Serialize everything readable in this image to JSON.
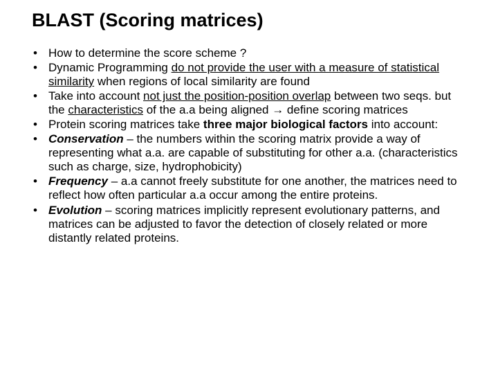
{
  "title": "BLAST (Scoring matrices)",
  "b1": "How to determine the score scheme ?",
  "b2a": "Dynamic Programming ",
  "b2b": "do not provide the user with a measure of statistical similarity",
  "b2c": " when regions of local similarity are found",
  "b3a": "Take into account ",
  "b3b": "not just the position-position overlap",
  "b3c": " between two seqs. but the ",
  "b3d": "characteristics",
  "b3e": " of the a.a being aligned ",
  "b3f": "→",
  "b3g": " define scoring matrices",
  "b4a": "Protein scoring matrices take ",
  "b4b": "three major biological factors",
  "b4c": " into account:",
  "b5a": "Conservation",
  "b5b": " – the numbers within the scoring matrix provide a way of representing what a.a. are capable of substituting for other a.a. (characteristics such as charge, size, hydrophobicity)",
  "b6a": "Frequency",
  "b6b": " – a.a cannot freely substitute for one another, the matrices need to reflect how often particular a.a occur among the entire proteins.",
  "b7a": "Evolution",
  "b7b": " – scoring matrices implicitly represent evolutionary patterns, and matrices can be adjusted to favor the detection of closely related or more distantly related proteins."
}
